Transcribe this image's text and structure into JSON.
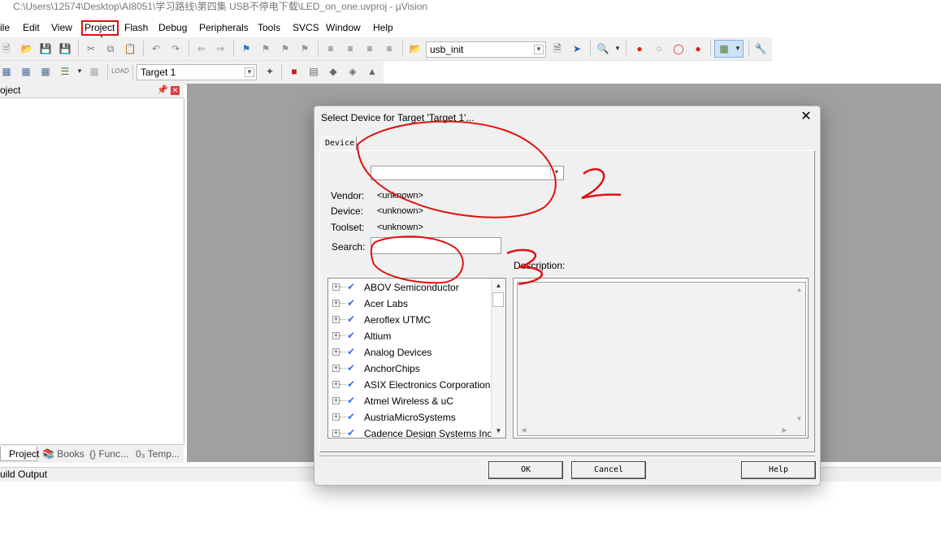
{
  "window": {
    "title": "C:\\Users\\12574\\Desktop\\AI8051\\学习路线\\第四集 USB不停电下载\\LED_on_one.uvproj - µVision"
  },
  "menu": {
    "items": [
      "ile",
      "Edit",
      "View",
      "Project",
      "Flash",
      "Debug",
      "Peripherals",
      "Tools",
      "SVCS",
      "Window",
      "Help"
    ],
    "highlighted": "Project"
  },
  "toolbar": {
    "function_combo": "usb_init",
    "target_combo": "Target 1"
  },
  "project_pane": {
    "title": "oject",
    "tabs": [
      "Project",
      "Books",
      "{} Func...",
      "0₃ Temp..."
    ]
  },
  "output_pane": {
    "title": "uild Output"
  },
  "dialog": {
    "title": "Select Device for Target 'Target 1'...",
    "tab": "Device",
    "combo_value": "",
    "vendor_label": "Vendor:",
    "vendor_value": "<unknown>",
    "device_label": "Device:",
    "device_value": "<unknown>",
    "toolset_label": "Toolset:",
    "toolset_value": "<unknown>",
    "search_label": "Search:",
    "search_value": "",
    "description_label": "Description:",
    "vendors": [
      "ABOV Semiconductor",
      "Acer Labs",
      "Aeroflex UTMC",
      "Altium",
      "Analog Devices",
      "AnchorChips",
      "ASIX Electronics Corporation",
      "Atmel Wireless & uC",
      "AustriaMicroSystems",
      "Cadence Design Systems Inc."
    ],
    "ok_label": "OK",
    "cancel_label": "Cancel",
    "help_label": "Help"
  },
  "annotations": {
    "mark_2": "2",
    "mark_3": "3"
  },
  "colors": {
    "annotation_red": "#e01010",
    "workspace_gray": "#a0a0a0"
  }
}
